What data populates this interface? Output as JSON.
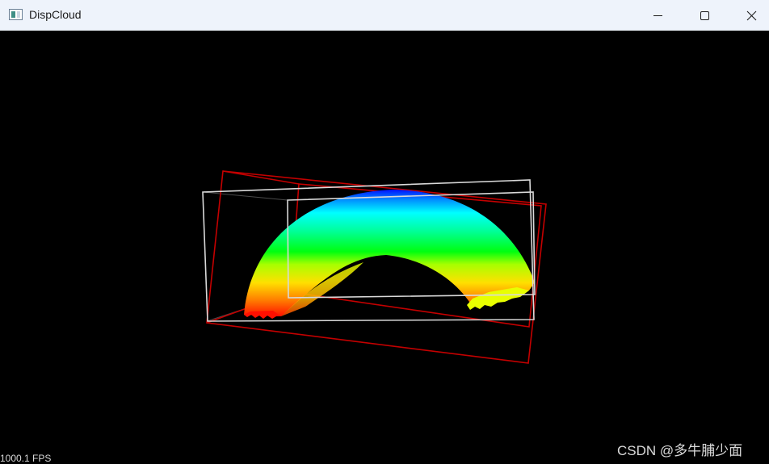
{
  "window": {
    "title": "DispCloud",
    "controls": {
      "minimize_icon": "minimize-icon",
      "maximize_icon": "maximize-icon",
      "close_icon": "close-icon"
    }
  },
  "viewer": {
    "background_color": "#000000",
    "fps_text": "1000.1 FPS",
    "point_cloud": {
      "shape": "arch",
      "colormap": "jet (red-yellow-green-cyan-blue by height)"
    },
    "bounding_boxes": [
      {
        "color": "#d9d9d9",
        "label": "white box"
      },
      {
        "color": "#c00000",
        "label": "red box"
      }
    ]
  },
  "watermark": {
    "text": "CSDN @多牛脯少面"
  }
}
